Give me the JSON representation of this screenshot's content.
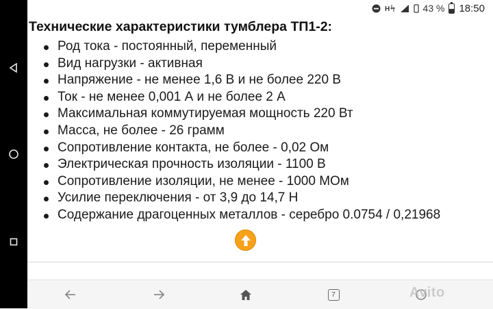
{
  "status_bar": {
    "battery_percent": "43 %",
    "time": "18:50",
    "battery_level": 0.43
  },
  "icons": {
    "nav_back": "triangle-back-icon",
    "nav_home": "circle-home-icon",
    "nav_recent": "square-recent-icon",
    "scroll_up": "arrow-up-icon",
    "tabs_count": "7"
  },
  "article": {
    "heading": "Технические характеристики тумблера ТП1-2:",
    "items": [
      "Род тока - постоянный, переменный",
      "Вид нагрузки - активная",
      "Напряжение - не менее 1,6 В и не более 220 В",
      "Ток - не менее 0,001 А и не более 2 А",
      "Максимальная коммутируемая мощность 220 Вт",
      "Масса, не более - 26 грамм",
      "Сопротивление контакта, не более - 0,02 Ом",
      "Электрическая прочность изоляции - 1100 В",
      "Сопротивление изоляции, не менее - 1000 МОм",
      "Усилие переключения - от 3,9 до 14,7 Н",
      "Содержание драгоценных металлов - серебро 0.0754 / 0,21968"
    ]
  },
  "watermark": "Avito",
  "colors": {
    "scroll_button": "#f7a21b",
    "nav_bar": "#000000",
    "toolbar": "#f5f5f5"
  }
}
